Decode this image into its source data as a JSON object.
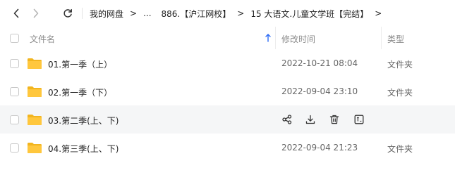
{
  "nav": {
    "back_icon": "chevron-left-icon",
    "forward_icon": "chevron-right-icon",
    "refresh_icon": "refresh-icon",
    "breadcrumb": [
      "我的网盘",
      "...",
      "886.【沪江网校】",
      "15 大语文.儿童文学班【完结】"
    ],
    "separator": ">"
  },
  "table": {
    "columns": {
      "name": "文件名",
      "modified": "修改时间",
      "type": "类型"
    },
    "sort": "ascending",
    "rows": [
      {
        "name": "01.第一季（上）",
        "modified": "2022-10-21 08:04",
        "type": "文件夹",
        "hovered": false
      },
      {
        "name": "02.第一季（下）",
        "modified": "2022-09-04 23:10",
        "type": "文件夹",
        "hovered": false
      },
      {
        "name": "03.第二季(上、下)",
        "modified": "",
        "type": "",
        "hovered": true
      },
      {
        "name": "04.第三季(上、下)",
        "modified": "2022-09-04 21:23",
        "type": "文件夹",
        "hovered": false
      }
    ],
    "row_actions": [
      "share-icon",
      "download-icon",
      "delete-icon",
      "rename-icon"
    ]
  },
  "colors": {
    "folder": "#ffc73d",
    "folder_tab": "#f2b51f",
    "sort_arrow": "#2c6bf5",
    "hover_row": "#f5f6f7"
  }
}
